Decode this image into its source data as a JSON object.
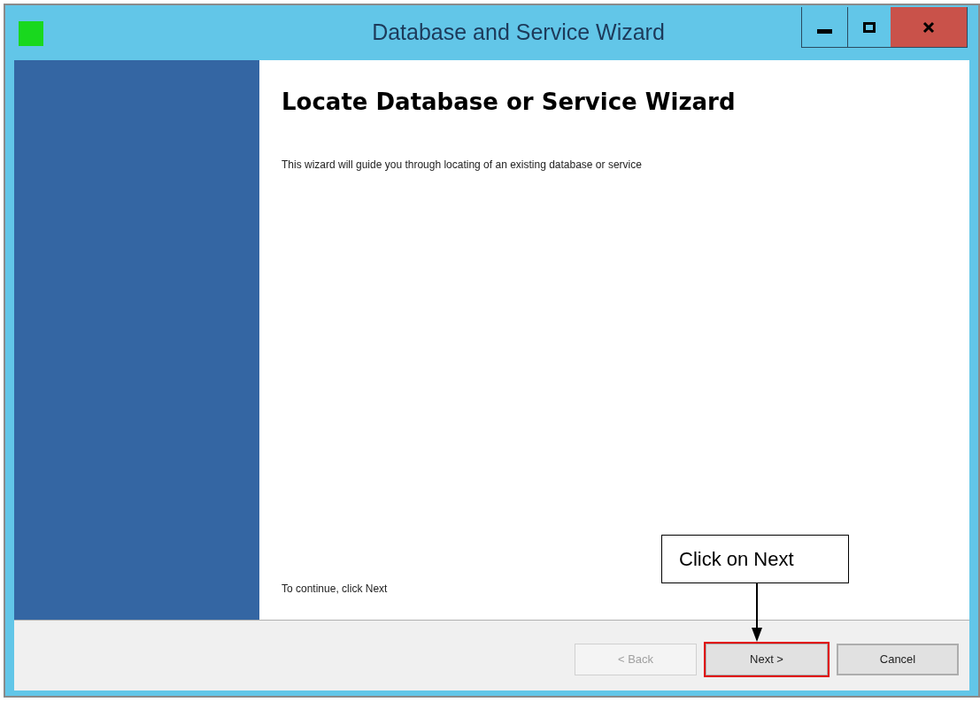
{
  "window": {
    "title": "Database and Service Wizard"
  },
  "page": {
    "heading": "Locate Database or Service Wizard",
    "description": "This wizard will guide you through locating of an existing database or service",
    "footer_text": "To continue, click Next"
  },
  "buttons": [
    {
      "label": "< Back",
      "disabled": true,
      "highlighted": false,
      "focused": false
    },
    {
      "label": "Next >",
      "disabled": false,
      "highlighted": true,
      "focused": false
    },
    {
      "label": "Cancel",
      "disabled": false,
      "highlighted": false,
      "focused": true
    }
  ],
  "callout": {
    "text": "Click on Next"
  }
}
